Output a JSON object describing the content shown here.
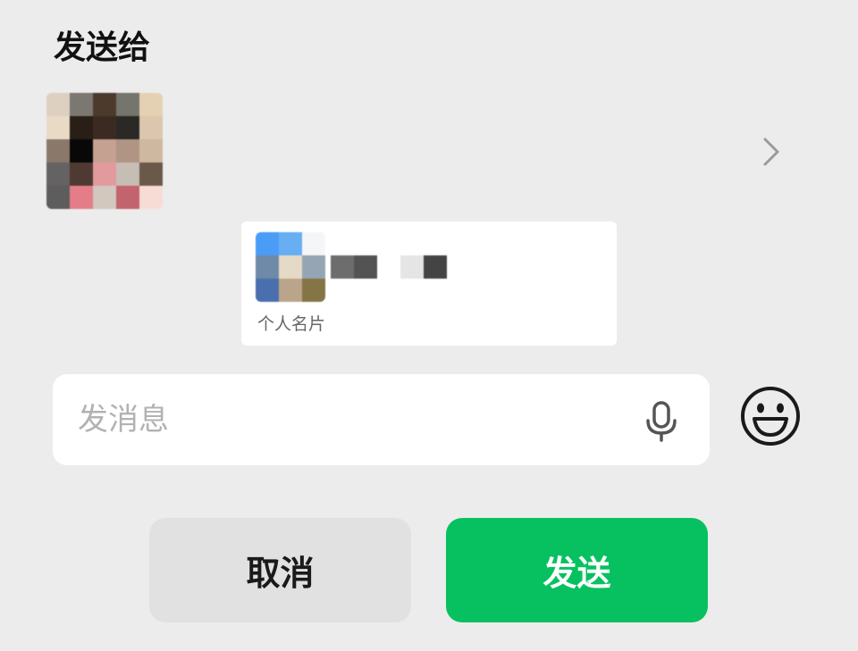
{
  "dialog": {
    "title": "发送给"
  },
  "recipient": {
    "avatar_colors": [
      "#ddd0c0",
      "#7b7871",
      "#4c3b2c",
      "#74756d",
      "#e4d1b3",
      "#e9dac6",
      "#2a1f16",
      "#3b2a22",
      "#2b2925",
      "#dcc6ae",
      "#8a786a",
      "#080808",
      "#c4a191",
      "#b09484",
      "#cfb8a0",
      "#646262",
      "#4e3a32",
      "#e39a9c",
      "#c6beb4",
      "#6a5849",
      "#5d5d5d",
      "#e57d89",
      "#d2c8be",
      "#c2636d",
      "#f7dcd6"
    ]
  },
  "card": {
    "label": "个人名片",
    "avatar_colors": [
      "#4a9cf7",
      "#67aef2",
      "#f4f6f8",
      "#6f8aa8",
      "#e5dac6",
      "#95a5b4",
      "#4a6fae",
      "#bba58a",
      "#857445"
    ],
    "name_colors": [
      "#6d6d6d",
      "#535353",
      "#ffffff",
      "#e5e5e5",
      "#444444"
    ]
  },
  "message": {
    "placeholder": "发消息"
  },
  "actions": {
    "cancel_label": "取消",
    "send_label": "发送"
  },
  "icons": {
    "chevron": "chevron-right-icon",
    "mic": "microphone-icon",
    "emoji": "emoji-smile-icon"
  },
  "colors": {
    "send_button": "#07c160",
    "cancel_button": "#e1e1e1",
    "background": "#ececec"
  }
}
